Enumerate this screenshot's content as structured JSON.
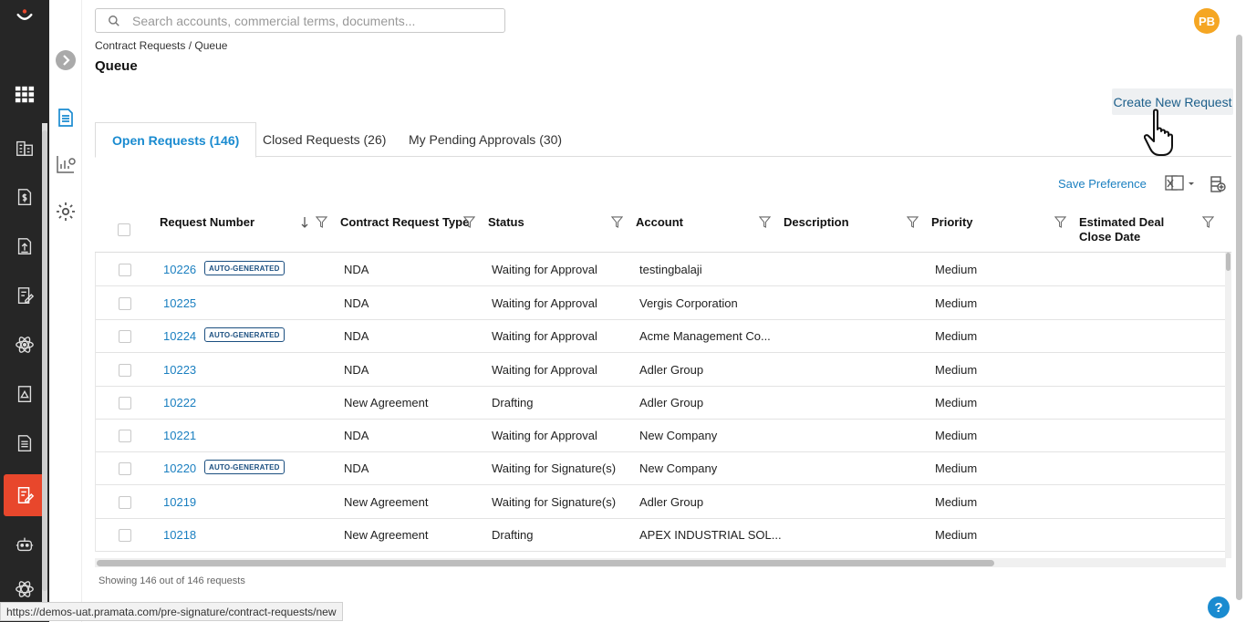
{
  "search": {
    "placeholder": "Search accounts, commercial terms, documents..."
  },
  "user": {
    "initials": "PB"
  },
  "breadcrumb": "Contract Requests / Queue",
  "page_title": "Queue",
  "create_button": "Create New Request",
  "tabs": [
    {
      "label": "Open Requests (146)",
      "active": true
    },
    {
      "label": "Closed Requests (26)",
      "active": false
    },
    {
      "label": "My Pending Approvals (30)",
      "active": false
    }
  ],
  "save_preference": "Save Preference",
  "columns": [
    "Request Number",
    "Contract Request Type",
    "Status",
    "Account",
    "Description",
    "Priority",
    "Estimated Deal Close Date"
  ],
  "badge_label": "AUTO-GENERATED",
  "rows": [
    {
      "number": "10226",
      "auto": true,
      "type": "NDA",
      "status": "Waiting for Approval",
      "account": "testingbalaji",
      "priority": "Medium"
    },
    {
      "number": "10225",
      "auto": false,
      "type": "NDA",
      "status": "Waiting for Approval",
      "account": "Vergis Corporation",
      "priority": "Medium"
    },
    {
      "number": "10224",
      "auto": true,
      "type": "NDA",
      "status": "Waiting for Approval",
      "account": "Acme Management Co...",
      "priority": "Medium"
    },
    {
      "number": "10223",
      "auto": false,
      "type": "NDA",
      "status": "Waiting for Approval",
      "account": "Adler Group",
      "priority": "Medium"
    },
    {
      "number": "10222",
      "auto": false,
      "type": "New Agreement",
      "status": "Drafting",
      "account": "Adler Group",
      "priority": "Medium"
    },
    {
      "number": "10221",
      "auto": false,
      "type": "NDA",
      "status": "Waiting for Approval",
      "account": "New Company",
      "priority": "Medium"
    },
    {
      "number": "10220",
      "auto": true,
      "type": "NDA",
      "status": "Waiting for Signature(s)",
      "account": "New Company",
      "priority": "Medium"
    },
    {
      "number": "10219",
      "auto": false,
      "type": "New Agreement",
      "status": "Waiting for Signature(s)",
      "account": "Adler Group",
      "priority": "Medium"
    },
    {
      "number": "10218",
      "auto": false,
      "type": "New Agreement",
      "status": "Drafting",
      "account": "APEX INDUSTRIAL SOL...",
      "priority": "Medium"
    }
  ],
  "footer_count": "Showing 146 out of 146 requests",
  "status_url": "https://demos-uat.pramata.com/pre-signature/contract-requests/new",
  "help_label": "?",
  "icons": {
    "rail": [
      "logo-icon",
      "apps-grid-icon",
      "buildings-icon",
      "dollar-document-icon",
      "upload-document-icon",
      "edit-document-icon",
      "atom-icon",
      "image-document-icon",
      "text-document-icon",
      "contract-request-icon",
      "robot-icon",
      "settings-atom-icon"
    ],
    "rail2": [
      "expand-chevron-icon",
      "document-icon",
      "report-chart-icon",
      "gear-icon"
    ]
  },
  "colors": {
    "accent": "#1a8bd0",
    "active_rail": "#e8472c",
    "avatar": "#f5a623",
    "badge": "#1b4f80"
  }
}
